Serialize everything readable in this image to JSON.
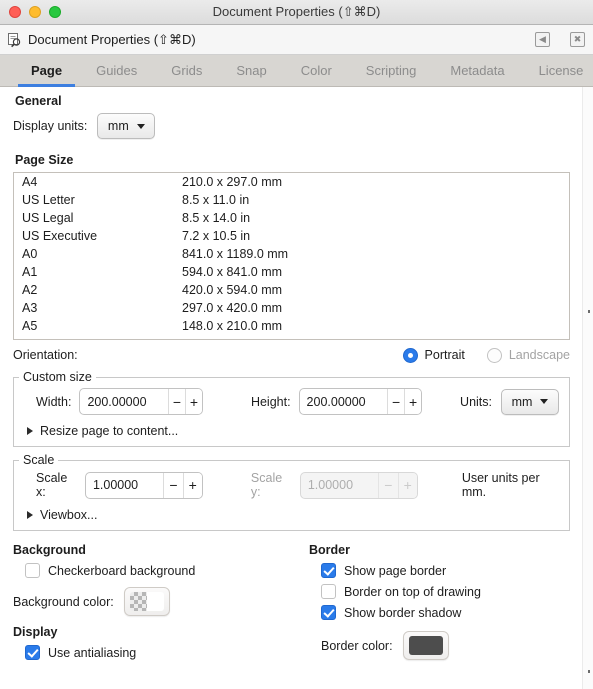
{
  "window": {
    "title": "Document Properties (⇧⌘D)",
    "traffic_lights": [
      "close-red",
      "minimize-yellow",
      "zoom-green"
    ]
  },
  "dock_header": {
    "icon": "document-properties-icon",
    "title": "Document Properties (⇧⌘D)",
    "buttons": [
      {
        "name": "collapse-dock-button",
        "glyph": "◀"
      },
      {
        "name": "close-dock-button",
        "glyph": "✖"
      }
    ]
  },
  "tabs": [
    {
      "label": "Page",
      "active": true
    },
    {
      "label": "Guides",
      "active": false
    },
    {
      "label": "Grids",
      "active": false
    },
    {
      "label": "Snap",
      "active": false
    },
    {
      "label": "Color",
      "active": false
    },
    {
      "label": "Scripting",
      "active": false
    },
    {
      "label": "Metadata",
      "active": false
    },
    {
      "label": "License",
      "active": false
    }
  ],
  "general": {
    "title": "General",
    "display_units_label": "Display units:",
    "display_units_value": "mm"
  },
  "page_size": {
    "title": "Page Size",
    "rows": [
      {
        "name": "A4",
        "dimensions": "210.0 x 297.0 mm"
      },
      {
        "name": "US Letter",
        "dimensions": "8.5 x 11.0 in"
      },
      {
        "name": "US Legal",
        "dimensions": "8.5 x 14.0 in"
      },
      {
        "name": "US Executive",
        "dimensions": "7.2 x 10.5 in"
      },
      {
        "name": "A0",
        "dimensions": "841.0 x 1189.0 mm"
      },
      {
        "name": "A1",
        "dimensions": "594.0 x 841.0 mm"
      },
      {
        "name": "A2",
        "dimensions": "420.0 x 594.0 mm"
      },
      {
        "name": "A3",
        "dimensions": "297.0 x 420.0 mm"
      },
      {
        "name": "A5",
        "dimensions": "148.0 x 210.0 mm"
      }
    ]
  },
  "orientation": {
    "label": "Orientation:",
    "options": [
      {
        "label": "Portrait",
        "selected": true
      },
      {
        "label": "Landscape",
        "selected": false
      }
    ]
  },
  "custom_size": {
    "legend": "Custom size",
    "width_label": "Width:",
    "width_value": "200.00000",
    "height_label": "Height:",
    "height_value": "200.00000",
    "units_label": "Units:",
    "units_value": "mm",
    "minus_glyph": "−",
    "plus_glyph": "+",
    "resize_disclosure": "Resize page to content..."
  },
  "scale": {
    "legend": "Scale",
    "scale_x_label": "Scale x:",
    "scale_x_value": "1.00000",
    "scale_y_label": "Scale y:",
    "scale_y_value": "1.00000",
    "units_note": "User units per mm.",
    "minus_glyph": "−",
    "plus_glyph": "+",
    "viewbox_disclosure": "Viewbox..."
  },
  "background": {
    "title": "Background",
    "checkerboard_label": "Checkerboard background",
    "checkerboard_checked": false,
    "color_label": "Background color:",
    "color_swatch": "checkerboard-white"
  },
  "display": {
    "title": "Display",
    "antialiasing_label": "Use antialiasing",
    "antialiasing_checked": true
  },
  "border": {
    "title": "Border",
    "show_page_border_label": "Show page border",
    "show_page_border_checked": true,
    "border_on_top_label": "Border on top of drawing",
    "border_on_top_checked": false,
    "show_border_shadow_label": "Show border shadow",
    "show_border_shadow_checked": true,
    "color_label": "Border color:",
    "color_value": "#4d4d4d"
  },
  "colors": {
    "accent": "#2a7bea",
    "tab_underline": "#3d7fe0",
    "tabbar_bg": "#d8d6d2",
    "border_swatch": "#4d4d4d"
  }
}
